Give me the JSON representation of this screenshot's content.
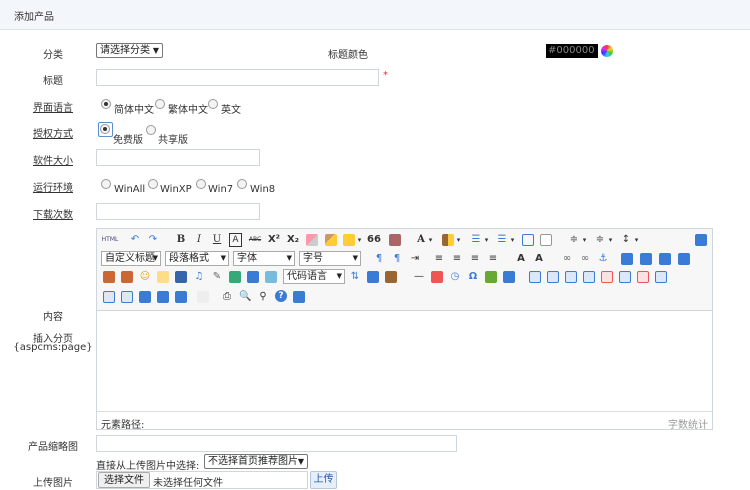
{
  "header": {
    "title": "添加产品"
  },
  "form": {
    "category": {
      "label": "分类",
      "selected": "请选择分类"
    },
    "title_color": {
      "label": "标题颜色",
      "value": "#000000"
    },
    "title": {
      "label": "标题",
      "required_mark": "*"
    },
    "language": {
      "label": "界面语言",
      "options": [
        "简体中文",
        "繁体中文",
        "英文"
      ],
      "selected": 0
    },
    "license": {
      "label": "授权方式",
      "options": [
        "免费版",
        "共享版"
      ],
      "selected": 0
    },
    "size": {
      "label": "软件大小"
    },
    "env": {
      "label": "运行环境",
      "options": [
        "WinAll",
        "WinXP",
        "Win7",
        "Win8"
      ]
    },
    "downloads": {
      "label": "下载次数"
    },
    "content": {
      "label": "内容",
      "pagebreak_label": "插入分页",
      "pagebreak_code": "{aspcms:page}"
    },
    "thumbnail": {
      "label": "产品缩略图",
      "pick_label": "直接从上传图片中选择:",
      "pick_selected": "不选择首页推荐图片"
    },
    "upload": {
      "label": "上传图片",
      "file_button": "选择文件",
      "file_status": "未选择任何文件",
      "upload_button": "上传"
    }
  },
  "editor": {
    "row1": {
      "html": "HTML",
      "bold": "B",
      "italic": "I",
      "underline": "U",
      "font_color": "A",
      "strike": "ABC",
      "sup": "X²",
      "sub": "X₂",
      "quote": "66"
    },
    "selects": {
      "custom_title": "自定义标题",
      "paragraph": "段落格式",
      "font": "字体",
      "font_size": "字号",
      "code_lang": "代码语言"
    },
    "status_path": "元素路径:",
    "word_count": "字数统计"
  },
  "colors": {
    "accent": "#3a7bd5",
    "border": "#cfd6de",
    "required": "#e03030"
  }
}
